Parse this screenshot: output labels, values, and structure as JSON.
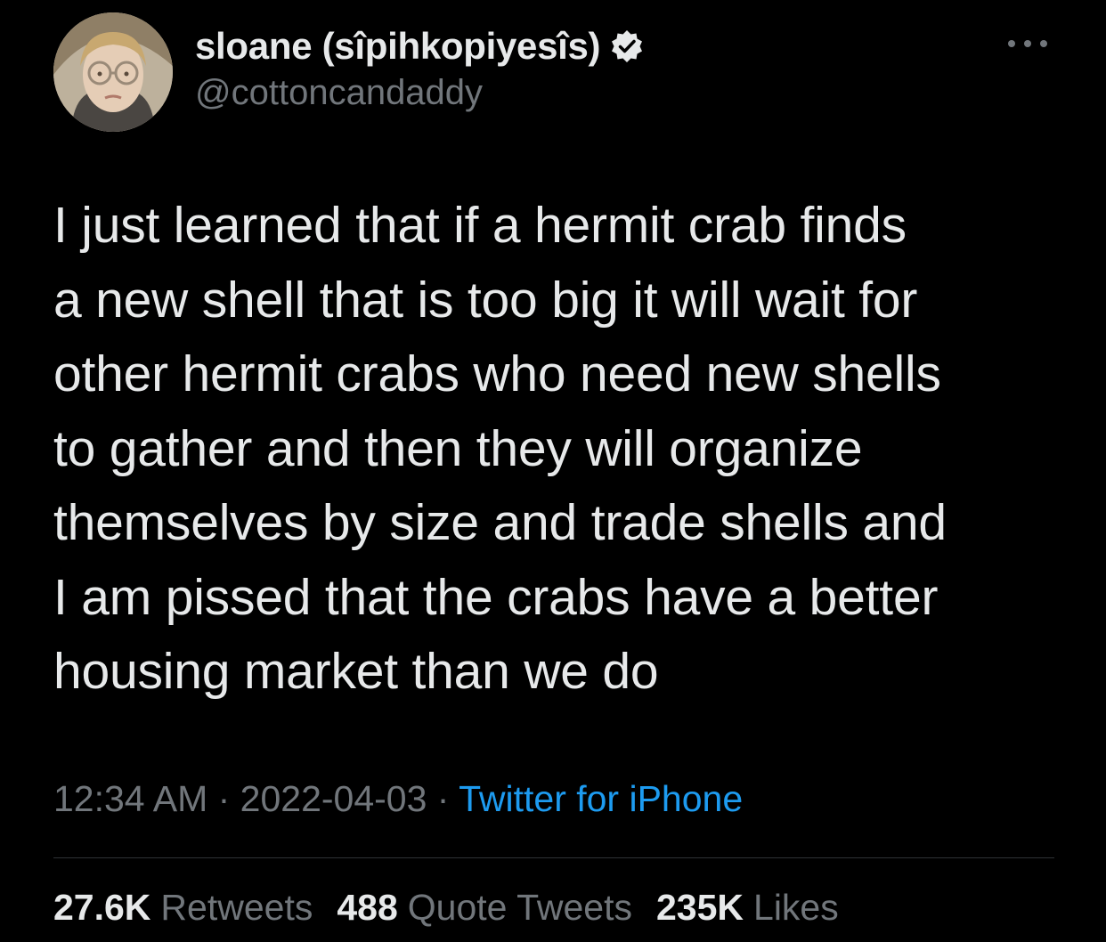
{
  "author": {
    "display_name": "sloane (sîpihkopiyesîs)",
    "handle": "@cottoncandaddy",
    "verified_icon": "verified-badge-icon",
    "avatar_icon": "profile-photo"
  },
  "menu": {
    "more_icon": "more-options-icon"
  },
  "tweet": {
    "text_lines": [
      "I just learned that if a hermit crab finds",
      "a new shell that is too big it will wait for",
      "other hermit crabs who need new shells",
      "to gather and then they will organize",
      "themselves by size and trade shells and",
      "I am pissed that the crabs have a better",
      "housing market than we do"
    ],
    "time": "12:34 AM",
    "separator": " · ",
    "date": "2022-04-03",
    "source": "Twitter for iPhone"
  },
  "stats": {
    "retweets_count": "27.6K",
    "retweets_label": "Retweets",
    "quotes_count": "488",
    "quotes_label": "Quote Tweets",
    "likes_count": "235K",
    "likes_label": "Likes"
  },
  "colors": {
    "background": "#000000",
    "primary_text": "#e7e9ea",
    "secondary_text": "#71767b",
    "link": "#1d9bf0",
    "divider": "#2f3336"
  }
}
